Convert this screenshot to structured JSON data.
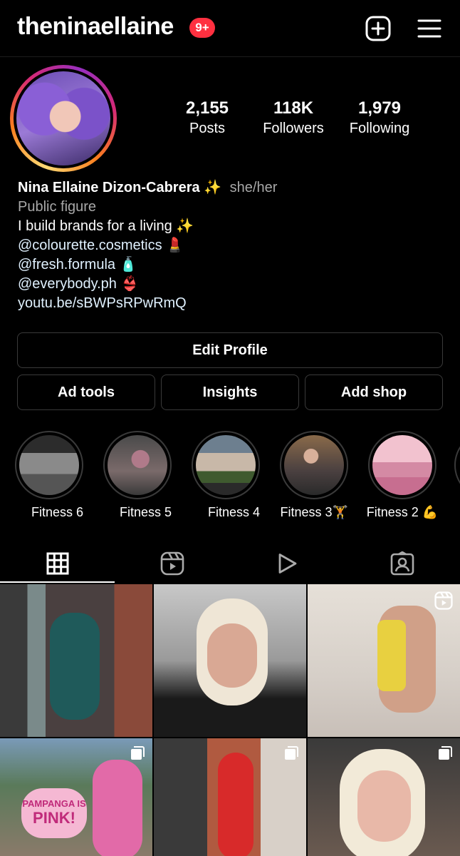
{
  "header": {
    "username": "theninaellaine",
    "notification_badge": "9+",
    "badge_color": "#ff3040",
    "icons": [
      "plus-square-icon",
      "hamburger-menu-icon"
    ]
  },
  "stats": [
    {
      "value": "2,155",
      "label": "Posts"
    },
    {
      "value": "118K",
      "label": "Followers"
    },
    {
      "value": "1,979",
      "label": "Following"
    }
  ],
  "bio": {
    "name": "Nina Ellaine Dizon-Cabrera ✨",
    "pronouns": "she/her",
    "category": "Public figure",
    "lines": [
      "I build brands for a living ✨",
      "@colourette.cosmetics 💄",
      "@fresh.formula 🧴",
      "@everybody.ph 👙"
    ],
    "link": "youtu.be/sBWPsRPwRmQ"
  },
  "buttons": {
    "edit_profile": "Edit Profile",
    "ad_tools": "Ad tools",
    "insights": "Insights",
    "add_shop": "Add shop"
  },
  "highlights": [
    {
      "label": "Fitness 6"
    },
    {
      "label": "Fitness 5"
    },
    {
      "label": "Fitness 4"
    },
    {
      "label": "Fitness 3🏋️"
    },
    {
      "label": "Fitness 2 💪"
    }
  ],
  "tabs": [
    {
      "icon": "grid-icon",
      "active": true
    },
    {
      "icon": "reels-icon",
      "active": false
    },
    {
      "icon": "play-icon",
      "active": false
    },
    {
      "icon": "tagged-icon",
      "active": false
    }
  ],
  "grid_posts": [
    {
      "description": "mirror selfie in green swimsuit",
      "badge": ""
    },
    {
      "description": "car selfie",
      "badge": ""
    },
    {
      "description": "laundry product video",
      "badge": "reel"
    },
    {
      "description": "Pampanga pink event",
      "badge": "carousel"
    },
    {
      "description": "gym mirror selfie in red",
      "badge": "carousel"
    },
    {
      "description": "portrait selfie",
      "badge": "carousel"
    }
  ],
  "grid_post_texts": [
    "PAMPANGA IS",
    "PINK!"
  ]
}
